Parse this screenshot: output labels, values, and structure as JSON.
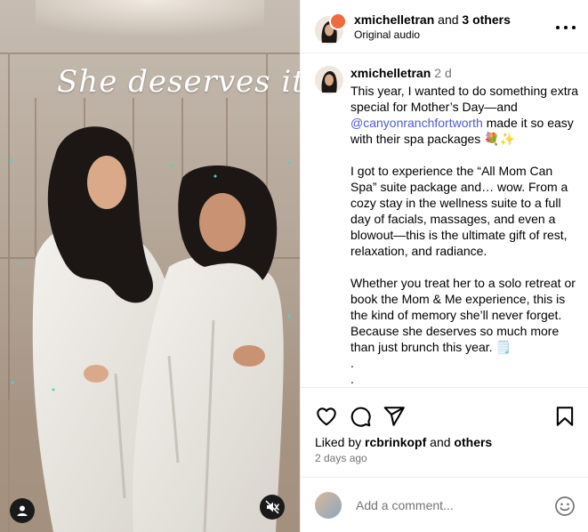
{
  "media": {
    "overlay_text": "She deserves it."
  },
  "header": {
    "username": "xmichelletran",
    "and_text": "and",
    "others_text": "3 others",
    "audio": "Original audio"
  },
  "caption": {
    "username": "xmichelletran",
    "time": "2 d",
    "p1_before": "This year, I wanted to do something extra special for Mother’s Day—and ",
    "mention": "@canyonranchfortworth",
    "p1_after": " made it so easy with their spa packages 💐✨",
    "p2": "I got to experience the “All Mom Can Spa” suite package and… wow. From a cozy stay in the wellness suite to a full day of facials, massages, and even a blowout—this is the ultimate gift of rest, relaxation, and radiance.",
    "p3": "Whether you treat her to a solo retreat or book the Mom & Me experience, this is the kind of memory she’ll never forget. Because she deserves so much more than just brunch this year. 🗒️",
    "dot1": ".",
    "dot2": "."
  },
  "likes": {
    "prefix": "Liked by",
    "user": "rcbrinkopf",
    "and_text": "and",
    "others": "others"
  },
  "date": "2 days ago",
  "comment": {
    "placeholder": "Add a comment..."
  },
  "icons": {
    "like": "heart-icon",
    "comment": "comment-icon",
    "share": "send-icon",
    "save": "bookmark-icon",
    "more": "more-horizontal-icon",
    "emoji": "emoji-icon",
    "mute": "speaker-muted-icon",
    "tag": "user-tag-icon"
  },
  "colors": {
    "mention": "#4d5bd2",
    "secondary_text": "#737373",
    "divider": "#efefef"
  }
}
